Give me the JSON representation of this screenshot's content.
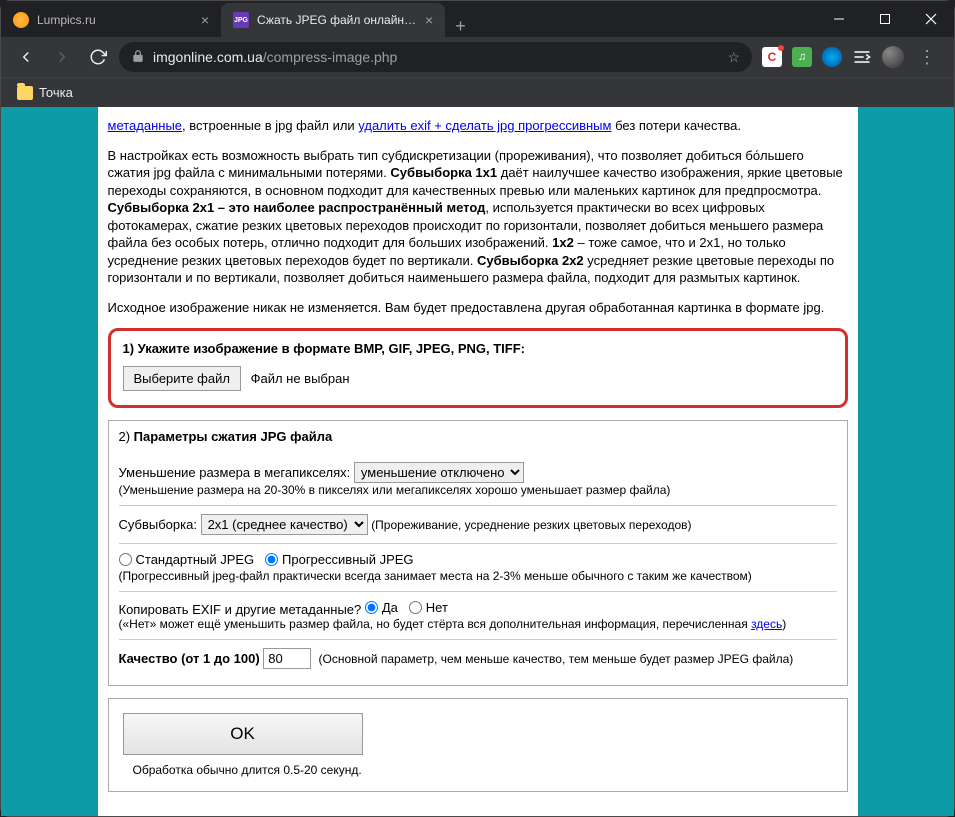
{
  "tabs": [
    {
      "title": "Lumpics.ru"
    },
    {
      "title": "Сжать JPEG файл онлайн - IMG"
    }
  ],
  "url": {
    "host": "imgonline.com.ua",
    "path": "/compress-image.php"
  },
  "bookmark": {
    "label": "Точка"
  },
  "intro": {
    "link_metadata": "метаданные",
    "after_metadata": ", встроенные в jpg файл или ",
    "link_delete_exif": "удалить exif + сделать jpg прогрессивным",
    "after_delete": " без потери качества.",
    "para2_a": "В настройках есть возможность выбрать тип субдискретизации (прореживания), что позволяет добиться бо́льшего сжатия jpg файла с минимальными потерями. ",
    "sub1x1_label": "Субвыборка 1x1",
    "sub1x1_text": " даёт наилучшее качество изображения, яркие цветовые переходы сохраняются, в основном подходит для качественных превью или маленьких картинок для предпросмотра. ",
    "sub2x1_label": "Субвыборка 2x1 – это наиболее распространённый метод",
    "sub2x1_text": ", используется практически во всех цифровых фотокамерах, сжатие резких цветовых переходов происходит по горизонтали, позволяет добиться меньшего размера файла без особых потерь, отлично подходит для больших изображений. ",
    "sub1x2_label": "1x2",
    "sub1x2_text": " – тоже самое, что и 2x1, но только усреднение резких цветовых переходов будет по вертикали. ",
    "sub2x2_label": "Субвыборка 2x2",
    "sub2x2_text": " усредняет резкие цветовые переходы по горизонтали и по вертикали, позволяет добиться наименьшего размера файла, подходит для размытых картинок.",
    "para3": "Исходное изображение никак не изменяется. Вам будет предоставлена другая обработанная картинка в формате jpg."
  },
  "section1": {
    "title": "1) Укажите изображение в формате BMP, GIF, JPEG, PNG, TIFF:",
    "button": "Выберите файл",
    "status": "Файл не выбран"
  },
  "section2": {
    "title_prefix": "2) ",
    "title": "Параметры сжатия JPG файла",
    "mp_label": "Уменьшение размера в мегапикселях: ",
    "mp_option": "уменьшение отключено",
    "mp_hint": "(Уменьшение размера на 20-30% в пикселях или мегапикселях хорошо уменьшает размер файла)",
    "subsample_label": "Субвыборка: ",
    "subsample_option": "2x1 (среднее качество)",
    "subsample_hint": "(Прореживание, усреднение резких цветовых переходов)",
    "jpeg_std": "Стандартный JPEG",
    "jpeg_prog": "Прогрессивный JPEG",
    "jpeg_hint": "(Прогрессивный jpeg-файл практически всегда занимает места на 2-3% меньше обычного с таким же качеством)",
    "exif_label": "Копировать EXIF и другие метаданные? ",
    "yes": "Да",
    "no": "Нет",
    "exif_hint_a": "(«Нет» может ещё уменьшить размер файла, но будет стёрта вся дополнительная информация, перечисленная ",
    "exif_hint_link": "здесь",
    "exif_hint_b": ")",
    "quality_label": "Качество (от 1 до 100) ",
    "quality_value": "80",
    "quality_hint": "(Основной параметр, чем меньше качество, тем меньше будет размер JPEG файла)"
  },
  "ok": {
    "button": "OK",
    "hint": "Обработка обычно длится 0.5-20 секунд."
  }
}
